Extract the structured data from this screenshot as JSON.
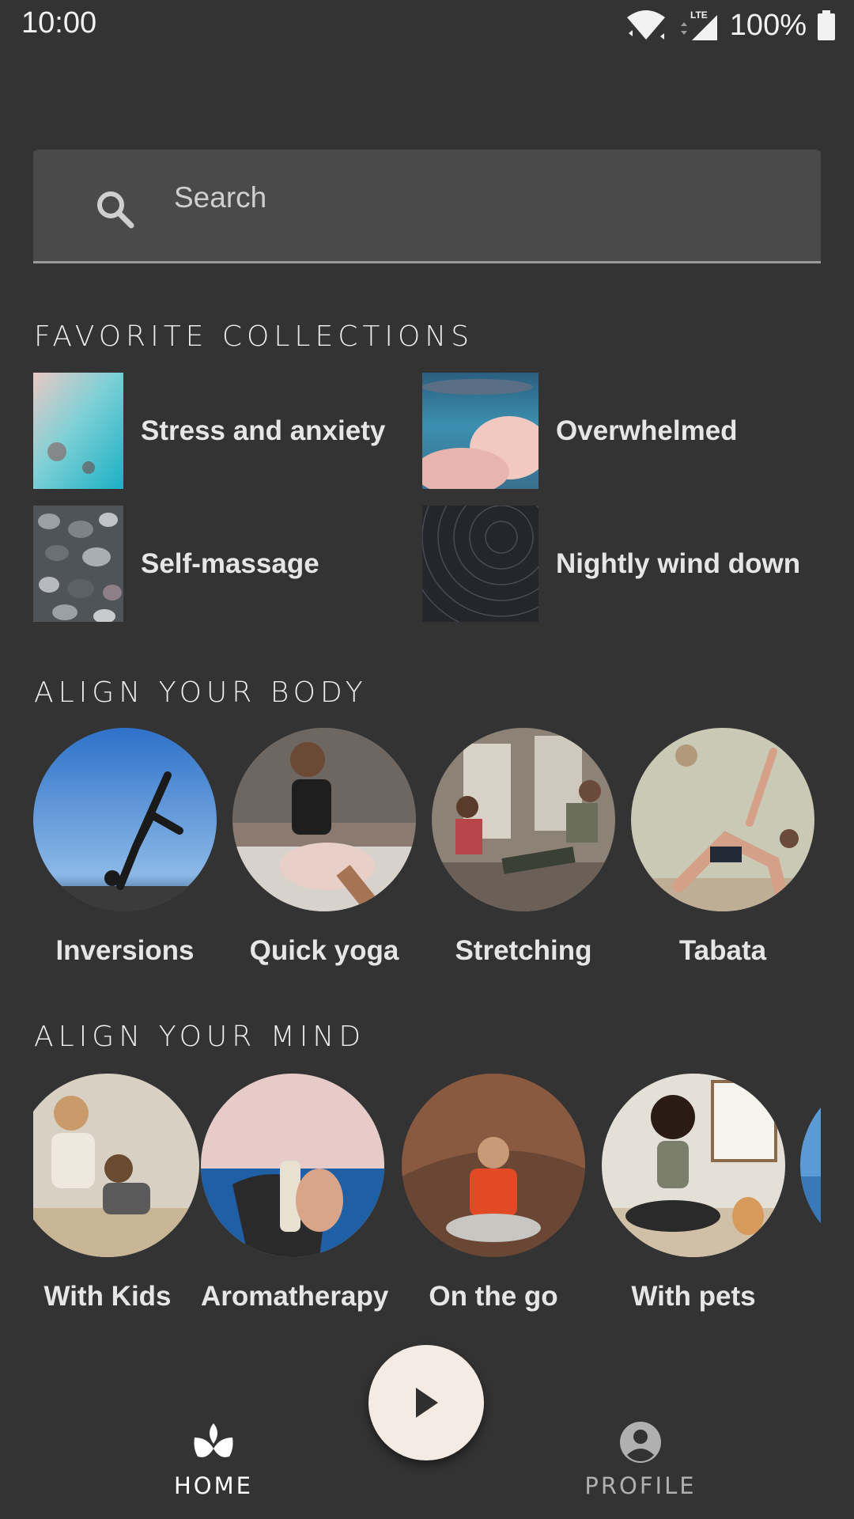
{
  "status": {
    "time": "10:00",
    "battery": "100%",
    "network": "LTE"
  },
  "search": {
    "placeholder": "Search"
  },
  "favorites": {
    "title": "FAVORITE COLLECTIONS",
    "items": [
      {
        "label": "Stress and anxiety"
      },
      {
        "label": "Overwhelmed"
      },
      {
        "label": "Self-massage"
      },
      {
        "label": "Nightly wind down"
      }
    ]
  },
  "body": {
    "title": "ALIGN YOUR BODY",
    "items": [
      {
        "label": "Inversions"
      },
      {
        "label": "Quick yoga"
      },
      {
        "label": "Stretching"
      },
      {
        "label": "Tabata"
      }
    ]
  },
  "mind": {
    "title": "ALIGN YOUR MIND",
    "items": [
      {
        "label": "With Kids"
      },
      {
        "label": "Aromatherapy"
      },
      {
        "label": "On the go"
      },
      {
        "label": "With pets"
      }
    ]
  },
  "nav": {
    "home": "HOME",
    "profile": "PROFILE"
  },
  "colors": {
    "background": "#333333",
    "fab": "#f4ece4",
    "active": "#ffffff",
    "inactive": "#b0b0b0"
  }
}
